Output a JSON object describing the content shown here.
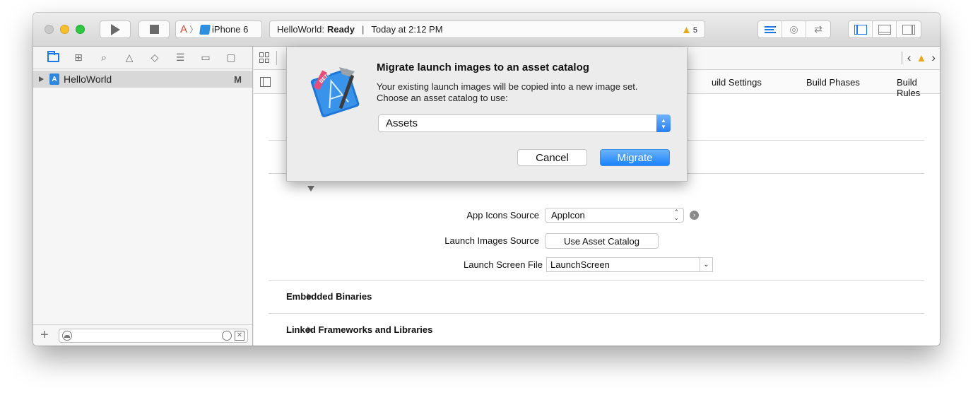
{
  "toolbar": {
    "scheme_device": "iPhone 6",
    "activity_app": "HelloWorld:",
    "activity_status": "Ready",
    "activity_divider": "|",
    "activity_time": "Today at 2:12 PM",
    "warning_count": "5"
  },
  "navigator": {
    "project_name": "HelloWorld",
    "project_badge": "M",
    "add_label": "+"
  },
  "editor": {
    "tabs": {
      "build_settings": "uild Settings",
      "build_phases": "Build Phases",
      "build_rules": "Build Rules"
    },
    "app_icons_label": "App Icons Source",
    "app_icons_value": "AppIcon",
    "launch_images_label": "Launch Images Source",
    "launch_images_button": "Use Asset Catalog",
    "launch_screen_label": "Launch Screen File",
    "launch_screen_value": "LaunchScreen",
    "section_embedded": "Embedded Binaries",
    "section_linked": "Linked Frameworks and Libraries"
  },
  "sheet": {
    "title": "Migrate launch images to an asset catalog",
    "message": "Your existing launch images will be copied into a new image set. Choose an asset catalog to use:",
    "catalog_value": "Assets",
    "cancel_label": "Cancel",
    "migrate_label": "Migrate",
    "icon_badge": "BETA"
  },
  "colors": {
    "accent": "#1c79e8",
    "warning": "#e9a818",
    "migrate_button": "#1a82fb"
  }
}
